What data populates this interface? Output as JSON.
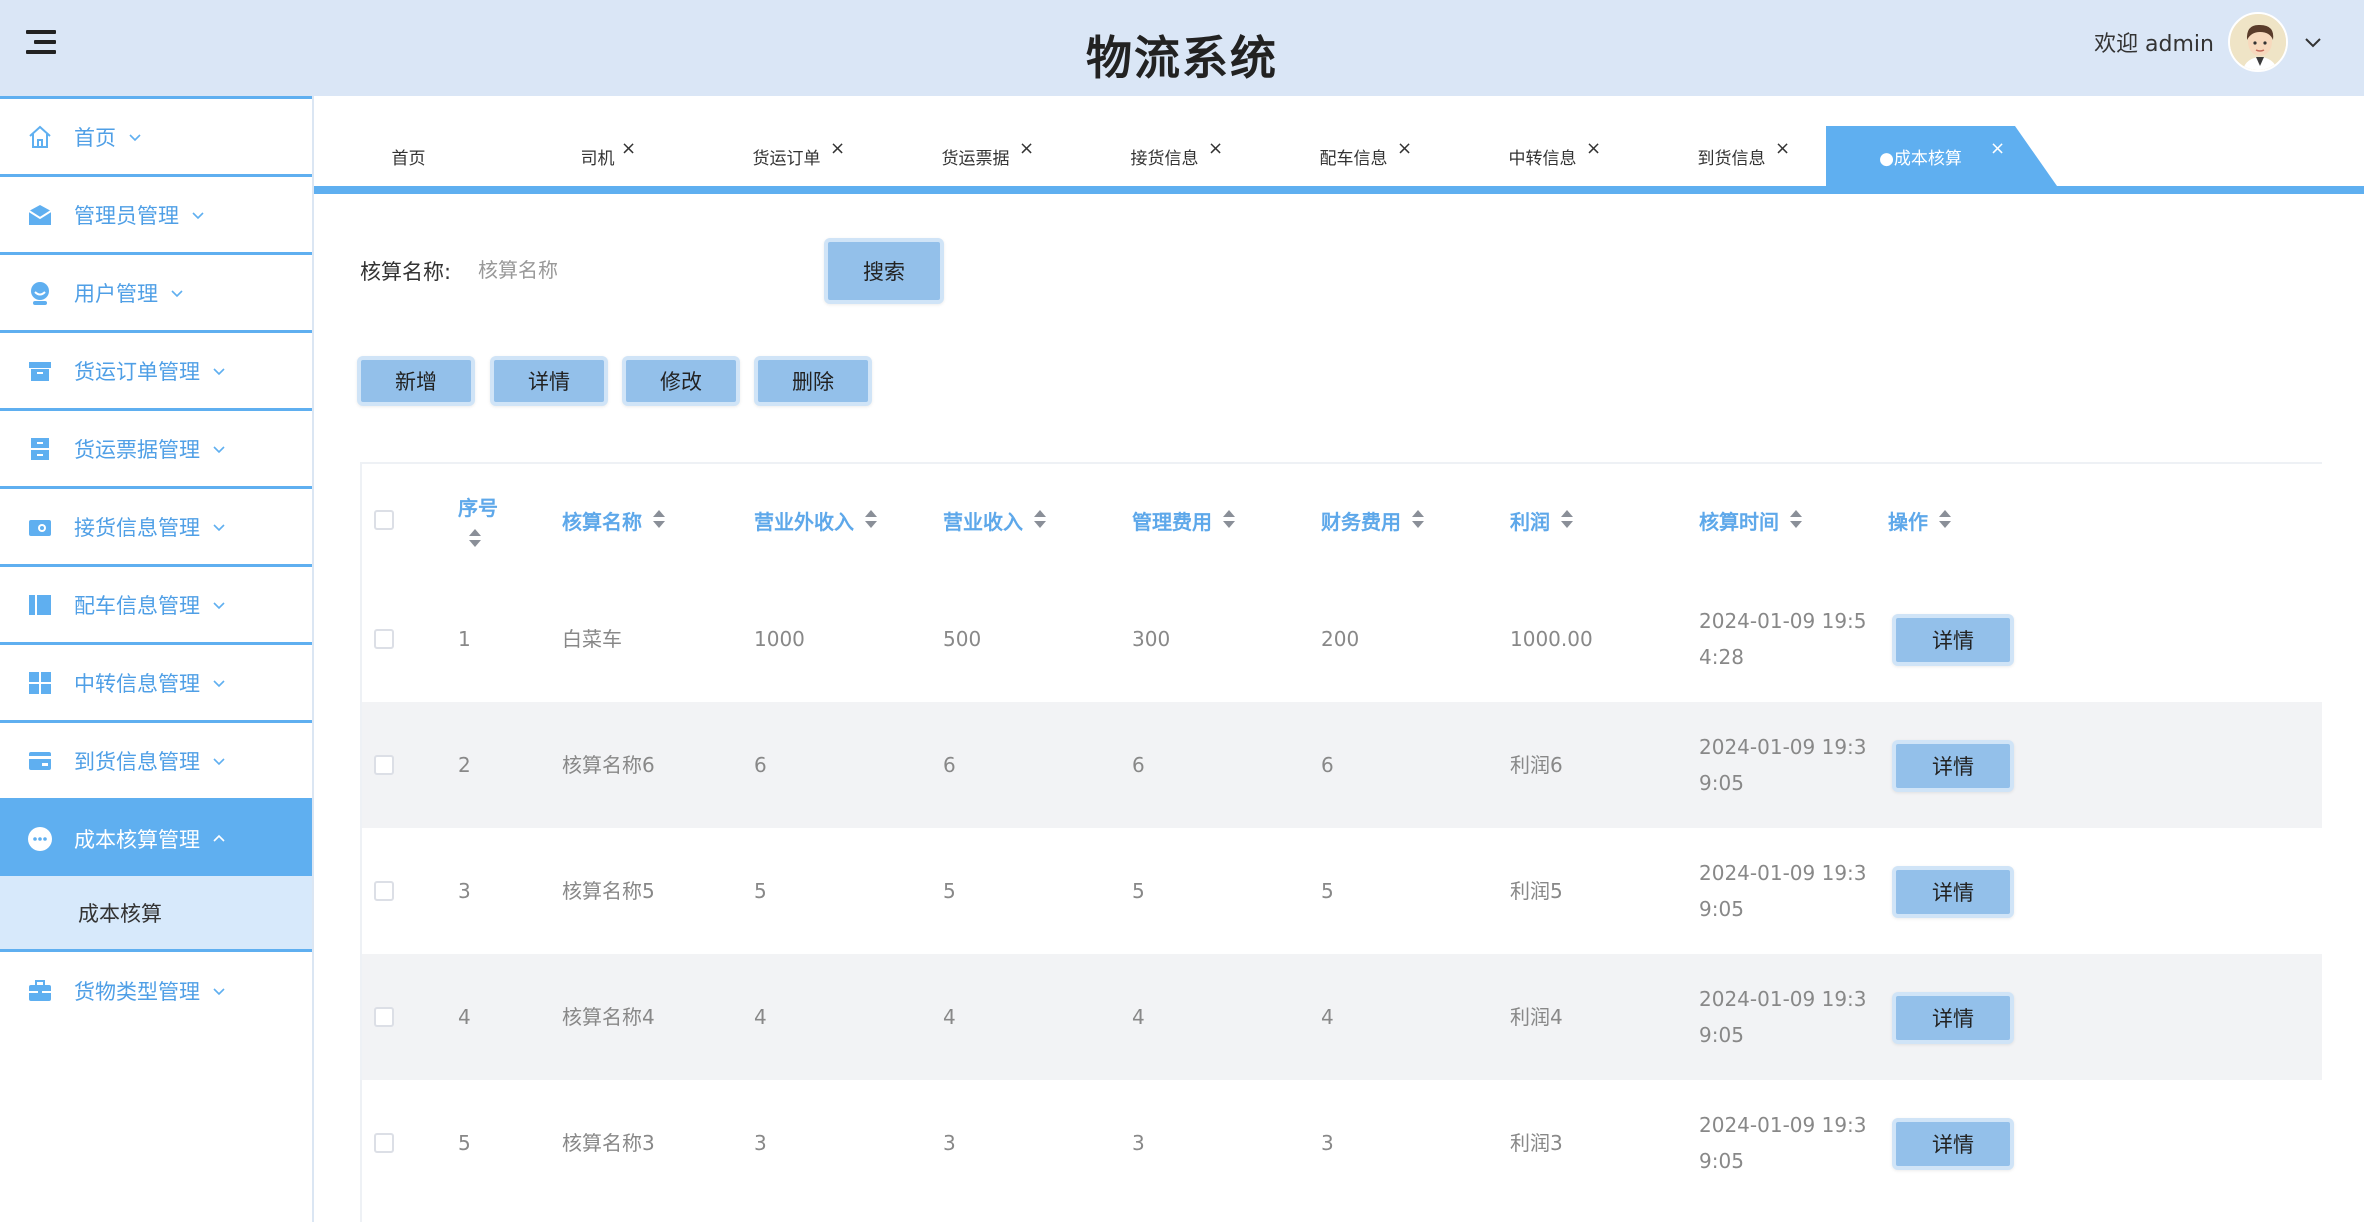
{
  "header": {
    "title": "物流系统",
    "welcome": "欢迎 admin"
  },
  "sidebar": {
    "items": [
      {
        "label": "首页",
        "icon": "home-icon"
      },
      {
        "label": "管理员管理",
        "icon": "mail-icon"
      },
      {
        "label": "用户管理",
        "icon": "user-icon"
      },
      {
        "label": "货运订单管理",
        "icon": "archive-icon"
      },
      {
        "label": "货运票据管理",
        "icon": "cabinet-icon"
      },
      {
        "label": "接货信息管理",
        "icon": "wallet-icon"
      },
      {
        "label": "配车信息管理",
        "icon": "book-icon"
      },
      {
        "label": "中转信息管理",
        "icon": "grid-icon"
      },
      {
        "label": "到货信息管理",
        "icon": "card-icon"
      },
      {
        "label": "成本核算管理",
        "icon": "more-icon"
      },
      {
        "label": "货物类型管理",
        "icon": "briefcase-icon"
      }
    ],
    "sub_item": "成本核算"
  },
  "tabs": [
    {
      "label": "首页"
    },
    {
      "label": "司机"
    },
    {
      "label": "货运订单"
    },
    {
      "label": "货运票据"
    },
    {
      "label": "接货信息"
    },
    {
      "label": "配车信息"
    },
    {
      "label": "中转信息"
    },
    {
      "label": "到货信息"
    },
    {
      "label": "●成本核算"
    }
  ],
  "tab_close": "×",
  "search": {
    "label": "核算名称:",
    "placeholder": "核算名称",
    "button": "搜索"
  },
  "actions": {
    "add": "新增",
    "detail": "详情",
    "edit": "修改",
    "delete": "删除"
  },
  "table": {
    "columns": [
      "序号",
      "核算名称",
      "营业外收入",
      "营业收入",
      "管理费用",
      "财务费用",
      "利润",
      "核算时间",
      "操作"
    ],
    "rows": [
      [
        "1",
        "白菜车",
        "1000",
        "500",
        "300",
        "200",
        "1000.00",
        "2024-01-09 19:54:28"
      ],
      [
        "2",
        "核算名称6",
        "6",
        "6",
        "6",
        "6",
        "利润6",
        "2024-01-09 19:39:05"
      ],
      [
        "3",
        "核算名称5",
        "5",
        "5",
        "5",
        "5",
        "利润5",
        "2024-01-09 19:39:05"
      ],
      [
        "4",
        "核算名称4",
        "4",
        "4",
        "4",
        "4",
        "利润4",
        "2024-01-09 19:39:05"
      ],
      [
        "5",
        "核算名称3",
        "3",
        "3",
        "3",
        "3",
        "利润3",
        "2024-01-09 19:39:05"
      ]
    ],
    "row_button": "详情"
  },
  "colors": {
    "accent": "#5faff0",
    "header_bg": "#dae6f6",
    "button_bg": "#93c0ea",
    "link_text": "#4f9fe6"
  }
}
